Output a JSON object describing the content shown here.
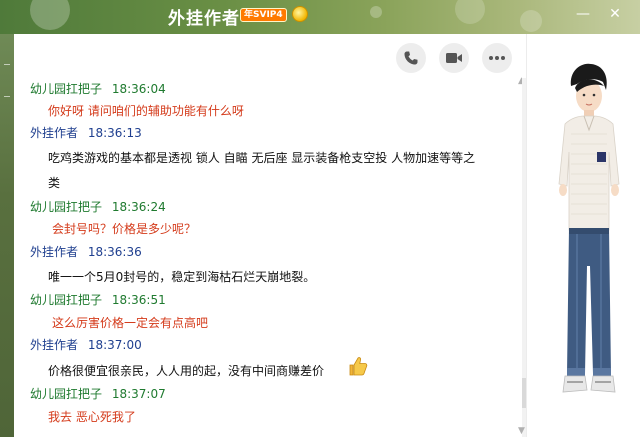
{
  "window": {
    "title": "外挂作者",
    "vip_badge": "年SVIP4",
    "controls": {
      "minimize": "—",
      "close": "✕"
    }
  },
  "toolbar": {
    "icons": [
      "phone-icon",
      "video-camera-icon",
      "more-icon"
    ]
  },
  "messages": [
    {
      "sender": "幼儿园扛把子",
      "time": "18:36:04",
      "text": "你好呀 请问咱们的辅助功能有什么呀",
      "role": "friend"
    },
    {
      "sender": "外挂作者",
      "time": "18:36:13",
      "text": "吃鸡类游戏的基本都是透视 锁人 自瞄 无后座 显示装备枪支空投 人物加速等等之",
      "text2": "类",
      "role": "me"
    },
    {
      "sender": "幼儿园扛把子",
      "time": "18:36:24",
      "text": "会封号吗？价格是多少呢？",
      "role": "friend"
    },
    {
      "sender": "外挂作者",
      "time": "18:36:36",
      "text": "唯一一个5月0封号的，稳定到海枯石烂天崩地裂。",
      "role": "me"
    },
    {
      "sender": "幼儿园扛把子",
      "time": "18:36:51",
      "text": "这么厉害价格一定会有点高吧",
      "role": "friend"
    },
    {
      "sender": "外挂作者",
      "time": "18:37:00",
      "text": "价格很便宜很亲民，人人用的起，没有中间商赚差价",
      "role": "me"
    },
    {
      "sender": "幼儿园扛把子",
      "time": "18:37:07",
      "text": "我去 恶心死我了",
      "role": "friend"
    }
  ],
  "colors": {
    "friend_name": "#1f7a2f",
    "me_name": "#1f3f8f",
    "friend_text": "#d43a1a",
    "me_text": "#111111",
    "titlebar": "#6a8f45"
  }
}
